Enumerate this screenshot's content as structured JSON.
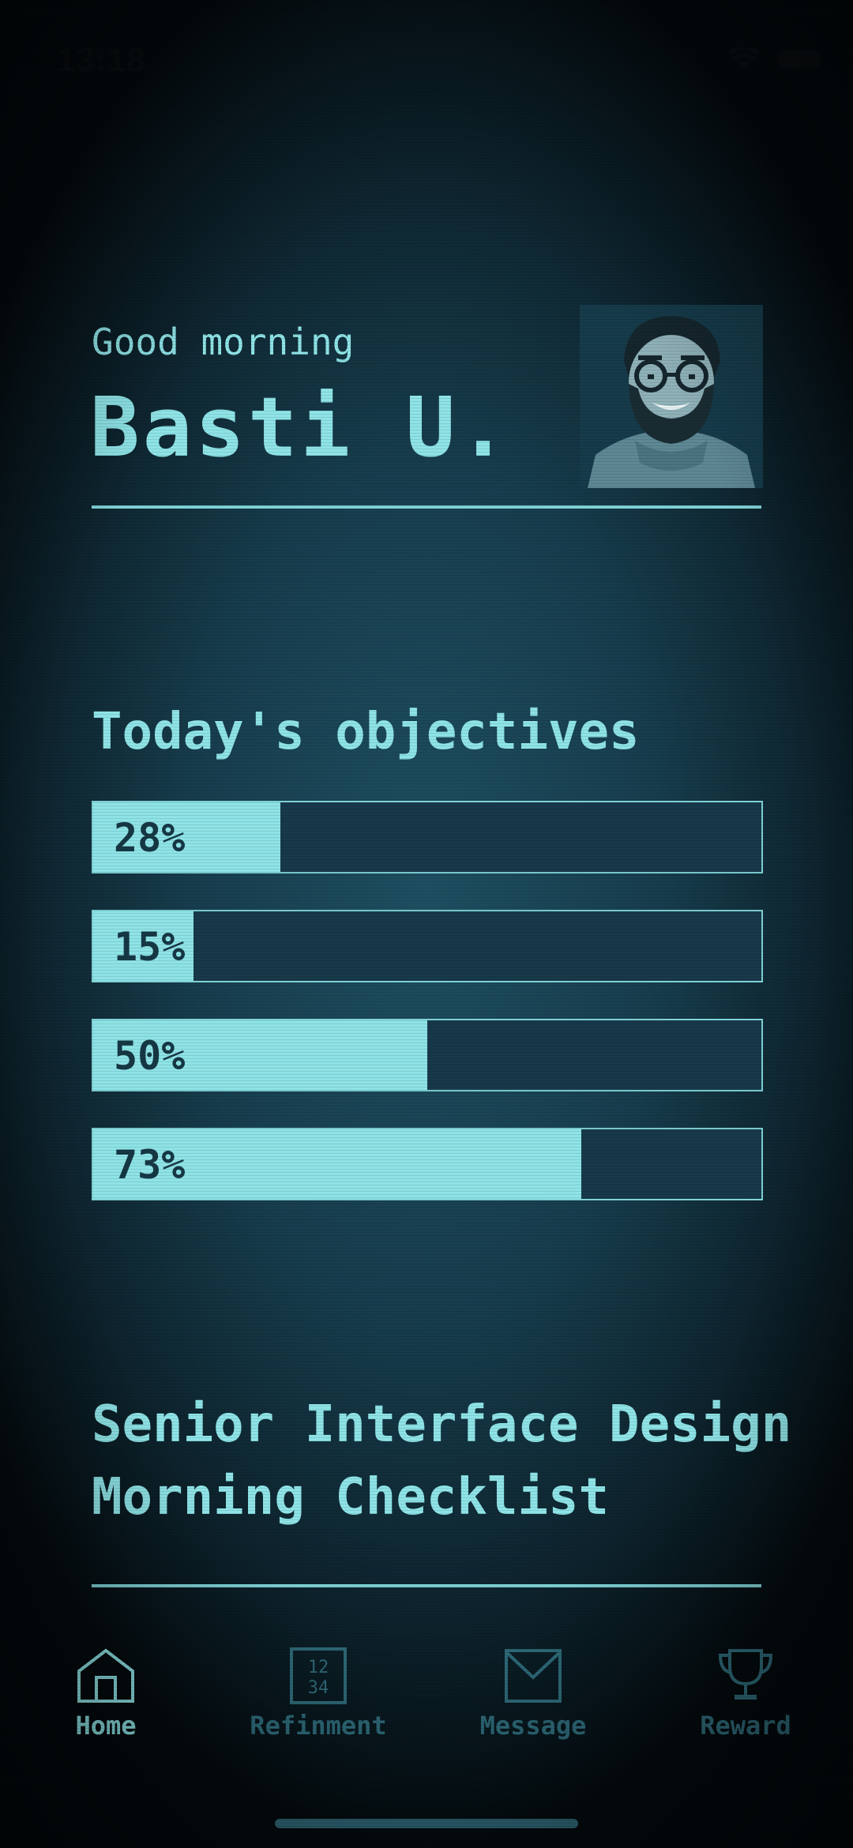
{
  "status_bar": {
    "time": "13:18",
    "wifi_icon": "wifi-icon",
    "battery_icon": "battery-icon"
  },
  "header": {
    "greeting": "Good morning",
    "name": "Basti U.",
    "avatar_icon": "avatar-portrait"
  },
  "objectives": {
    "title": "Today's objectives",
    "items": [
      {
        "label": "28%",
        "progress": 0.28
      },
      {
        "label": "15%",
        "progress": 0.15
      },
      {
        "label": "50%",
        "progress": 0.5
      },
      {
        "label": "73%",
        "progress": 0.73
      }
    ]
  },
  "checklist": {
    "line1": "Senior Interface Design",
    "line2": "Morning Checklist"
  },
  "tabbar": {
    "items": [
      {
        "label": "Home",
        "icon": "home-icon",
        "active": true
      },
      {
        "label": "Refinment",
        "icon": "calendar-icon",
        "icon_text_top": "12",
        "icon_text_bottom": "34",
        "active": false
      },
      {
        "label": "Message",
        "icon": "envelope-icon",
        "active": false
      },
      {
        "label": "Reward",
        "icon": "trophy-icon",
        "active": false
      }
    ]
  },
  "colors": {
    "accent": "#8ee3e6",
    "inactive": "#2e6a79",
    "background": "#173d4d"
  }
}
